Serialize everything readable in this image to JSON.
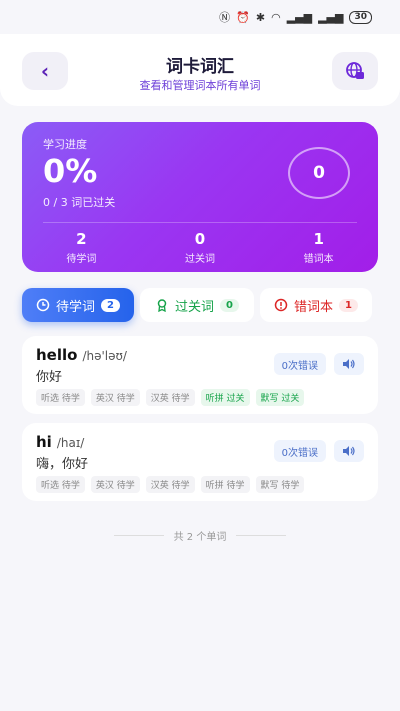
{
  "status_bar": {
    "battery": "30"
  },
  "header": {
    "title": "词卡词汇",
    "subtitle": "查看和管理词本所有单词"
  },
  "progress": {
    "label": "学习进度",
    "percent": "0%",
    "summary": "0 / 3 词已过关",
    "circle_value": "0",
    "stats": [
      {
        "num": "2",
        "label": "待学词"
      },
      {
        "num": "0",
        "label": "过关词"
      },
      {
        "num": "1",
        "label": "错词本"
      }
    ]
  },
  "tabs": [
    {
      "label": "待学词",
      "count": "2"
    },
    {
      "label": "过关词",
      "count": "0"
    },
    {
      "label": "错词本",
      "count": "1"
    }
  ],
  "words": [
    {
      "word": "hello",
      "phonetic": "/hə'ləʊ/",
      "meaning": "你好",
      "errors": "0次错误",
      "tags": [
        {
          "text": "听选 待学",
          "status": "pending"
        },
        {
          "text": "英汉 待学",
          "status": "pending"
        },
        {
          "text": "汉英 待学",
          "status": "pending"
        },
        {
          "text": "听拼 过关",
          "status": "pass"
        },
        {
          "text": "默写 过关",
          "status": "pass"
        }
      ]
    },
    {
      "word": "hi",
      "phonetic": "/haɪ/",
      "meaning": "嗨，你好",
      "errors": "0次错误",
      "tags": [
        {
          "text": "听选 待学",
          "status": "pending"
        },
        {
          "text": "英汉 待学",
          "status": "pending"
        },
        {
          "text": "汉英 待学",
          "status": "pending"
        },
        {
          "text": "听拼 待学",
          "status": "pending"
        },
        {
          "text": "默写 待学",
          "status": "pending"
        }
      ]
    }
  ],
  "footer": {
    "text": "共 2 个单词"
  },
  "colors": {
    "accent": "#8b5cf6",
    "active_tab": "#2563eb",
    "pass": "#16a34a",
    "wrong": "#dc2626"
  }
}
